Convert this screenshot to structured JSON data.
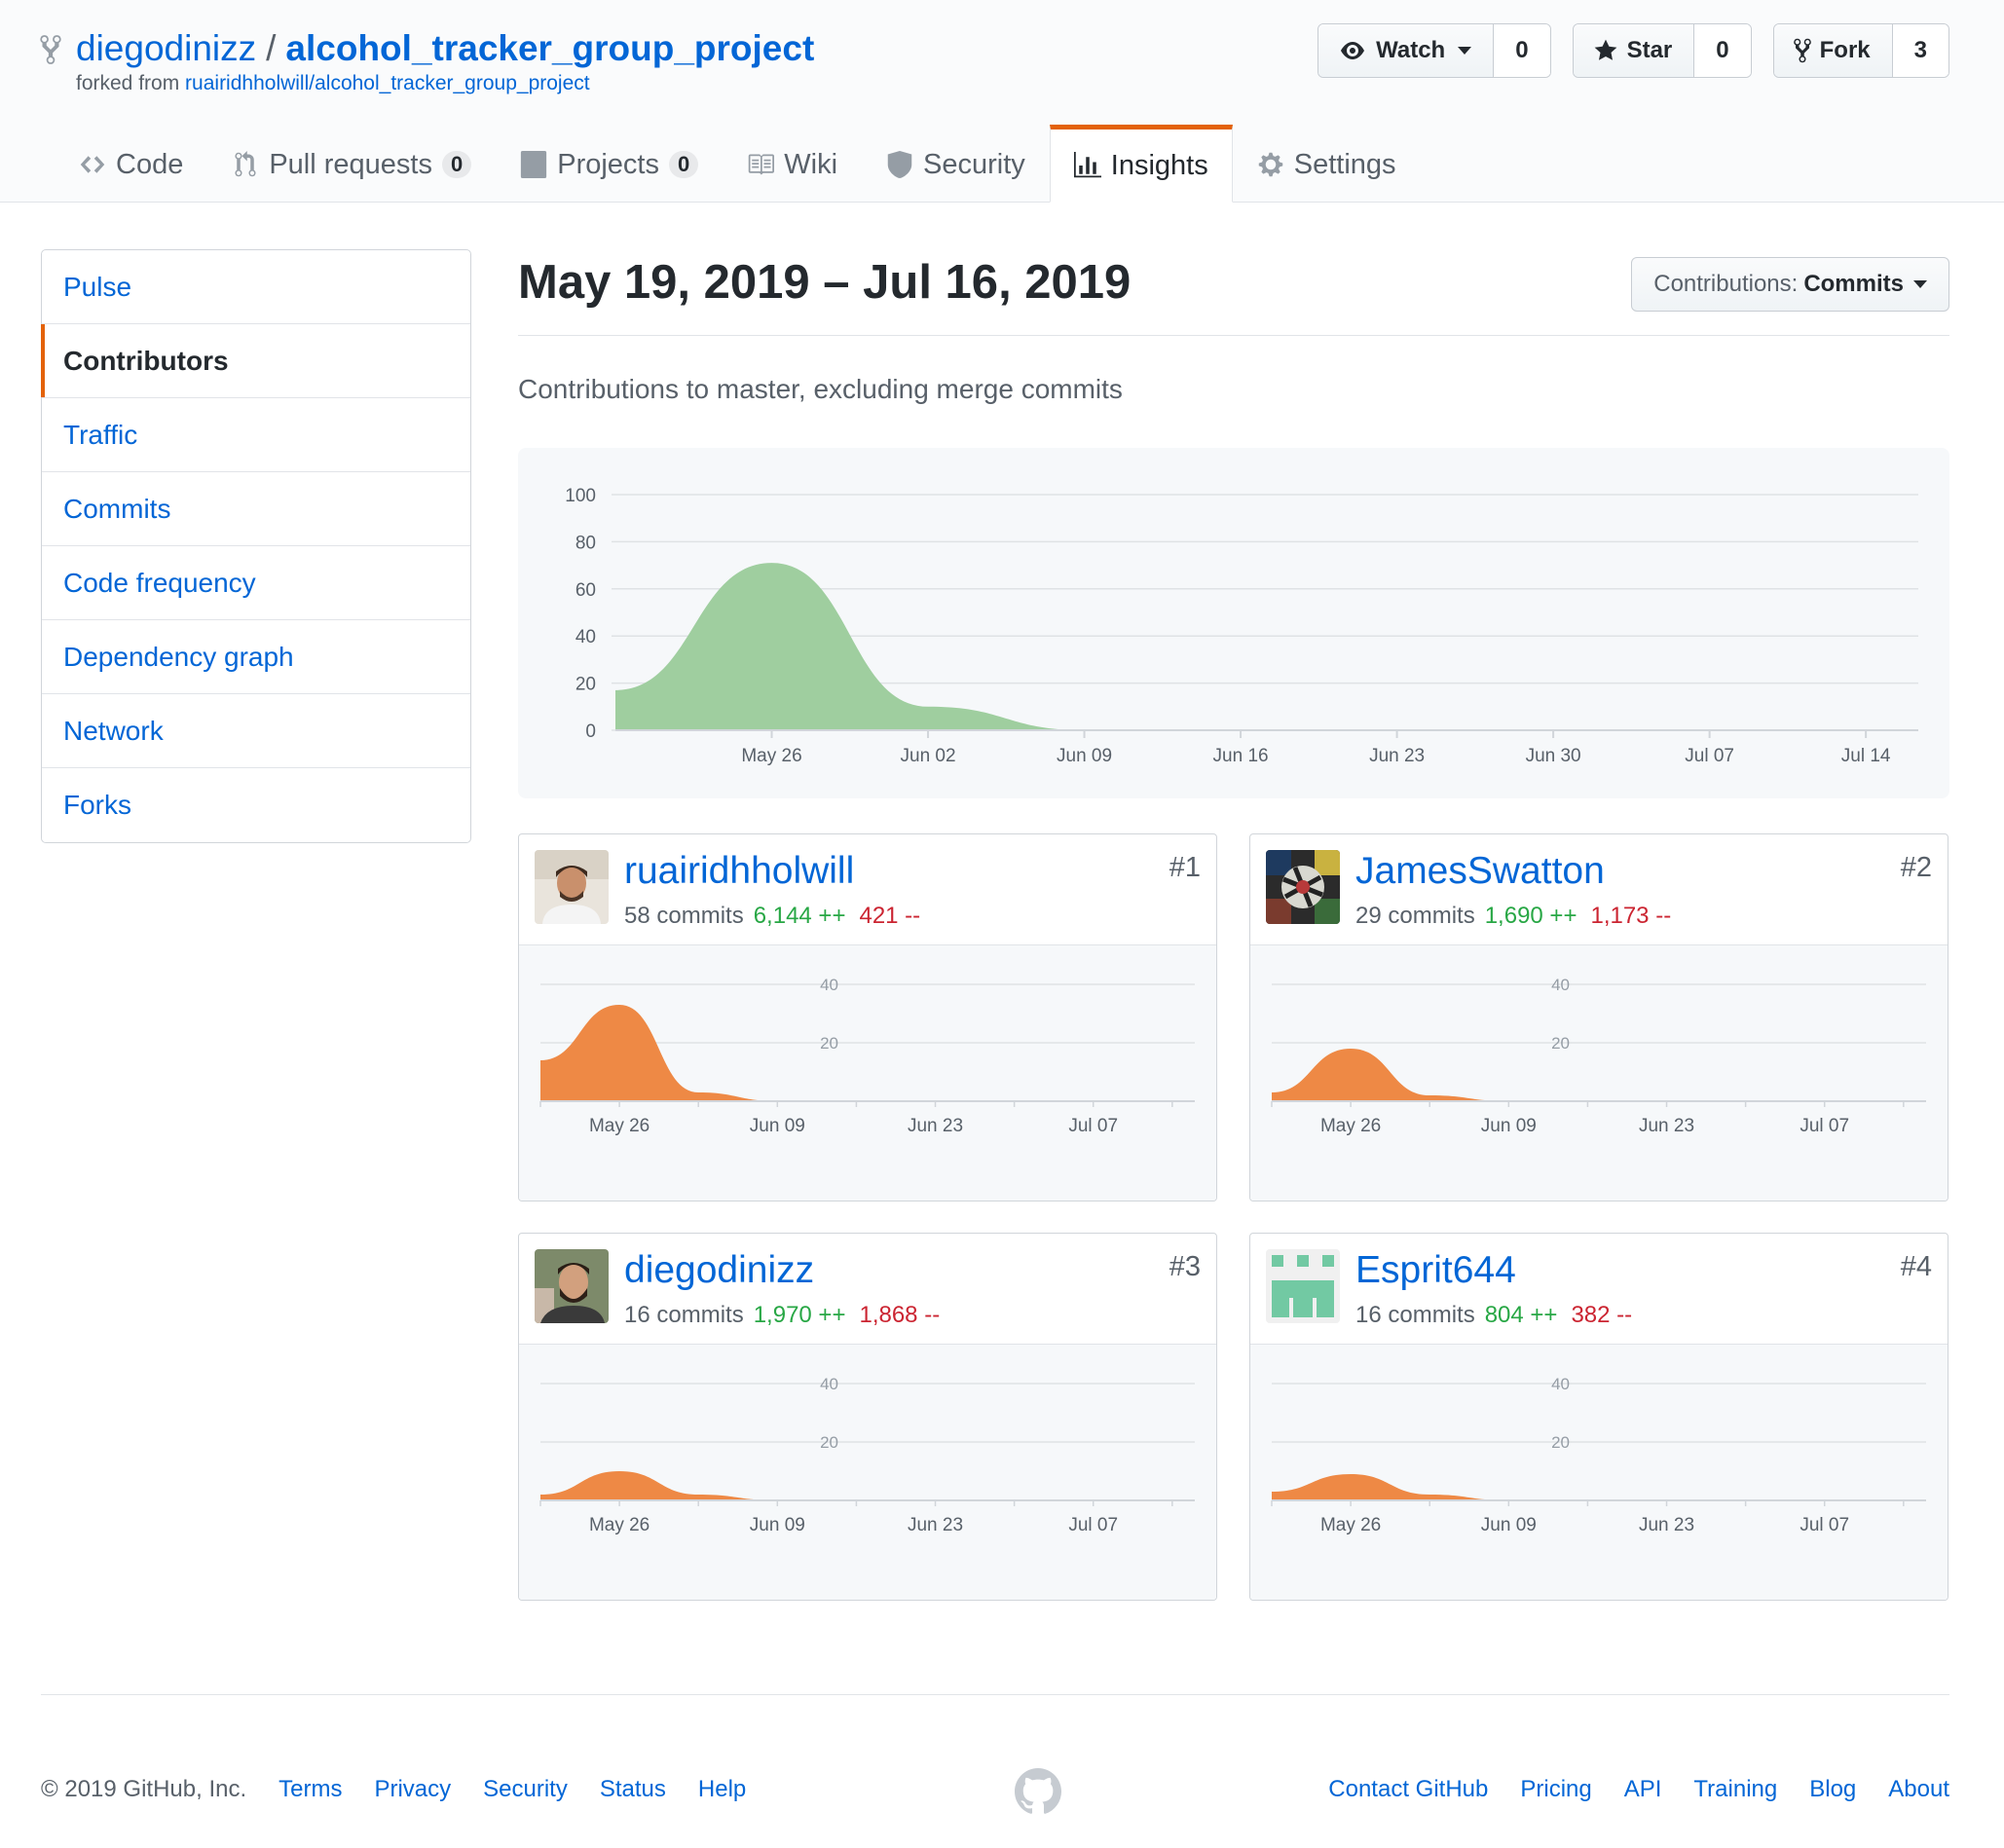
{
  "repo": {
    "owner": "diegodinizz",
    "separator": "/",
    "name": "alcohol_tracker_group_project",
    "forked_from_label": "forked from",
    "forked_from_link": "ruairidhholwill/alcohol_tracker_group_project"
  },
  "actions": {
    "watch": {
      "label": "Watch",
      "count": "0",
      "icon": "eye-icon"
    },
    "star": {
      "label": "Star",
      "count": "0",
      "icon": "star-icon"
    },
    "fork": {
      "label": "Fork",
      "count": "3",
      "icon": "fork-icon"
    }
  },
  "tabs": [
    {
      "label": "Code",
      "icon": "code-icon"
    },
    {
      "label": "Pull requests",
      "counter": "0",
      "icon": "pull-request-icon"
    },
    {
      "label": "Projects",
      "counter": "0",
      "icon": "project-icon"
    },
    {
      "label": "Wiki",
      "icon": "book-icon"
    },
    {
      "label": "Security",
      "icon": "shield-icon"
    },
    {
      "label": "Insights",
      "icon": "graph-icon",
      "selected": true
    },
    {
      "label": "Settings",
      "icon": "gear-icon"
    }
  ],
  "sidebar": {
    "items": [
      {
        "label": "Pulse"
      },
      {
        "label": "Contributors",
        "selected": true
      },
      {
        "label": "Traffic"
      },
      {
        "label": "Commits"
      },
      {
        "label": "Code frequency"
      },
      {
        "label": "Dependency graph"
      },
      {
        "label": "Network"
      },
      {
        "label": "Forks"
      }
    ]
  },
  "main": {
    "date_range": "May 19, 2019 – Jul 16, 2019",
    "contributions_select": {
      "prefix": "Contributions:",
      "value": "Commits"
    },
    "subtitle": "Contributions to master, excluding merge commits"
  },
  "chart_data": [
    {
      "type": "area",
      "title": "",
      "x_labels": [
        "May 26",
        "Jun 02",
        "Jun 09",
        "Jun 16",
        "Jun 23",
        "Jun 30",
        "Jul 07",
        "Jul 14"
      ],
      "y_ticks": [
        0,
        20,
        40,
        60,
        80,
        100
      ],
      "ylim": [
        0,
        100
      ],
      "xlim": [
        "2019-05-19",
        "2019-07-16"
      ],
      "series": [
        {
          "color": "#9fce9f",
          "x": [
            "2019-05-19",
            "2019-05-26",
            "2019-06-02",
            "2019-06-09",
            "2019-06-16",
            "2019-06-23",
            "2019-06-30",
            "2019-07-07",
            "2019-07-14"
          ],
          "y": [
            17,
            71,
            10,
            0,
            0,
            0,
            0,
            0,
            0
          ]
        }
      ],
      "grid": true
    },
    {
      "type": "area",
      "contributor": "ruairidhholwill",
      "x_labels": [
        "May 26",
        "Jun 09",
        "Jun 23",
        "Jul 07"
      ],
      "y_ticks": [
        20,
        40
      ],
      "ylim": [
        0,
        40
      ],
      "series": [
        {
          "color": "#ee8945",
          "x": [
            "2019-05-19",
            "2019-05-26",
            "2019-06-02",
            "2019-06-09"
          ],
          "y": [
            14,
            33,
            3,
            0
          ]
        }
      ]
    },
    {
      "type": "area",
      "contributor": "JamesSwatton",
      "x_labels": [
        "May 26",
        "Jun 09",
        "Jun 23",
        "Jul 07"
      ],
      "y_ticks": [
        20,
        40
      ],
      "ylim": [
        0,
        40
      ],
      "series": [
        {
          "color": "#ee8945",
          "x": [
            "2019-05-19",
            "2019-05-26",
            "2019-06-02",
            "2019-06-09"
          ],
          "y": [
            3,
            18,
            2,
            0
          ]
        }
      ]
    },
    {
      "type": "area",
      "contributor": "diegodinizz",
      "x_labels": [
        "May 26",
        "Jun 09",
        "Jun 23",
        "Jul 07"
      ],
      "y_ticks": [
        20,
        40
      ],
      "ylim": [
        0,
        40
      ],
      "series": [
        {
          "color": "#ee8945",
          "x": [
            "2019-05-19",
            "2019-05-26",
            "2019-06-02",
            "2019-06-09"
          ],
          "y": [
            2,
            10,
            2,
            0
          ]
        }
      ]
    },
    {
      "type": "area",
      "contributor": "Esprit644",
      "x_labels": [
        "May 26",
        "Jun 09",
        "Jun 23",
        "Jul 07"
      ],
      "y_ticks": [
        20,
        40
      ],
      "ylim": [
        0,
        40
      ],
      "series": [
        {
          "color": "#ee8945",
          "x": [
            "2019-05-19",
            "2019-05-26",
            "2019-06-02",
            "2019-06-09"
          ],
          "y": [
            3,
            9,
            2,
            0
          ]
        }
      ]
    }
  ],
  "contributors": [
    {
      "name": "ruairidhholwill",
      "commits": "58 commits",
      "additions": "6,144 ++",
      "deletions": "421 --",
      "rank": "#1"
    },
    {
      "name": "JamesSwatton",
      "commits": "29 commits",
      "additions": "1,690 ++",
      "deletions": "1,173 --",
      "rank": "#2"
    },
    {
      "name": "diegodinizz",
      "commits": "16 commits",
      "additions": "1,970 ++",
      "deletions": "1,868 --",
      "rank": "#3"
    },
    {
      "name": "Esprit644",
      "commits": "16 commits",
      "additions": "804 ++",
      "deletions": "382 --",
      "rank": "#4"
    }
  ],
  "footer": {
    "copyright": "© 2019 GitHub, Inc.",
    "left_links": [
      "Terms",
      "Privacy",
      "Security",
      "Status",
      "Help"
    ],
    "right_links": [
      "Contact GitHub",
      "Pricing",
      "API",
      "Training",
      "Blog",
      "About"
    ],
    "logo_icon": "github-mark-icon"
  },
  "colors": {
    "link": "#0366d6",
    "accent_tab": "#e36209",
    "main_area": "#9fce9f",
    "contributor_area": "#ee8945",
    "additions": "#28a745",
    "deletions": "#cb2431"
  }
}
